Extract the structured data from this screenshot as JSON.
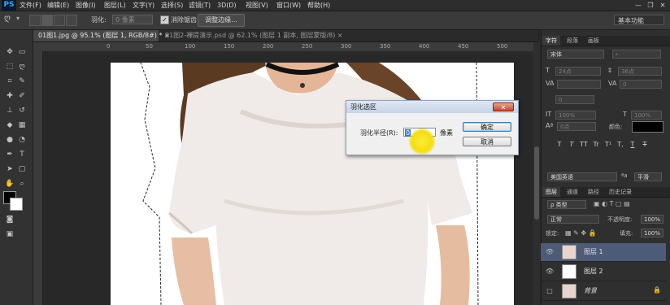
{
  "app": {
    "logo": "PS"
  },
  "menu": [
    "文件(F)",
    "编辑(E)",
    "图像(I)",
    "图层(L)",
    "文字(Y)",
    "选择(S)",
    "滤镜(T)",
    "3D(D)",
    "视图(V)",
    "窗口(W)",
    "帮助(H)"
  ],
  "window_controls": {
    "minimize": "—",
    "restore": "❐",
    "close": "✕"
  },
  "options": {
    "feather_label": "羽化:",
    "feather_value": "0 像素",
    "antialias_label": "消除锯齿",
    "refine_edge": "调整边缘...",
    "workspace": "基本功能"
  },
  "tabs": [
    {
      "label": "01图1.jpg @ 95.1% (图层 1, RGB/8#) * ×"
    },
    {
      "label": "01图2-裸提演示.psd @ 62.1% (图层 1 副本, 图层蒙版/8) ×"
    }
  ],
  "ruler_numbers": [
    "0",
    "50",
    "100",
    "150",
    "200",
    "250",
    "300",
    "350",
    "400",
    "450",
    "500"
  ],
  "dialog": {
    "title": "羽化选区",
    "close": "✕",
    "label": "羽化半径(R):",
    "value": "0",
    "unit": "像素",
    "ok": "确定",
    "cancel": "取消"
  },
  "character_panel": {
    "tabs": [
      "字符",
      "段落",
      "画板"
    ],
    "font_family": "宋体",
    "font_style": "-",
    "size": "24点",
    "leading": "36点",
    "kerning": "",
    "tracking": "0",
    "vscale": "100%",
    "hscale": "100%",
    "baseline": "0点",
    "color_label": "颜色:",
    "styles": [
      "T",
      "T",
      "TT",
      "Tr",
      "T¹",
      "T,",
      "T",
      "T"
    ],
    "language": "美国英语",
    "aa_label": "ªa",
    "aa_value": "平滑"
  },
  "layers_panel": {
    "tabs": [
      "图层",
      "通道",
      "路径",
      "历史记录"
    ],
    "kind_label": "ρ 类型",
    "blend_mode": "正常",
    "opacity_label": "不透明度:",
    "opacity_value": "100%",
    "lock_label": "锁定:",
    "fill_label": "填充:",
    "fill_value": "100%",
    "layers": [
      {
        "name": "图层 1",
        "selected": true
      },
      {
        "name": "图层 2",
        "selected": false
      },
      {
        "name": "背景",
        "selected": false
      }
    ]
  },
  "colors": {
    "accent": "#3375d6",
    "selected_layer": "#4b5b78",
    "cursor": "#f5dd10"
  }
}
